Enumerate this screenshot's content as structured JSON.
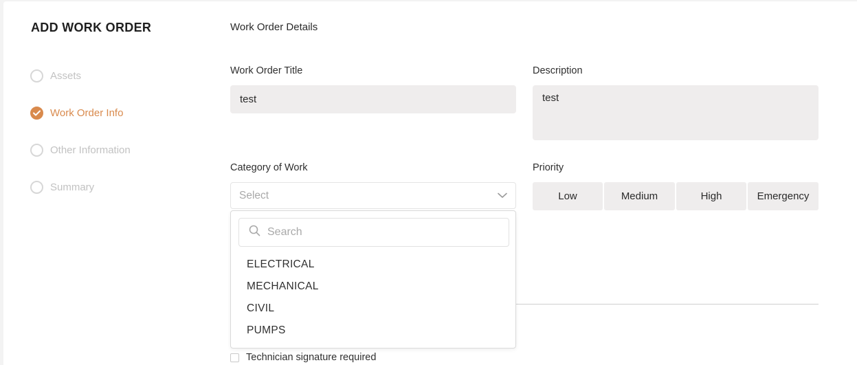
{
  "page": {
    "title": "ADD WORK ORDER"
  },
  "steps": [
    {
      "label": "Assets",
      "state": "pending"
    },
    {
      "label": "Work Order Info",
      "state": "done"
    },
    {
      "label": "Other Information",
      "state": "pending"
    },
    {
      "label": "Summary",
      "state": "pending"
    }
  ],
  "section": {
    "title": "Work Order Details"
  },
  "form": {
    "title_label": "Work Order Title",
    "title_value": "test",
    "description_label": "Description",
    "description_value": "test",
    "category_label": "Category of Work",
    "category_placeholder": "Select",
    "priority_label": "Priority",
    "priority_options": [
      "Low",
      "Medium",
      "High",
      "Emergency"
    ],
    "signature_label": "Technician signature required"
  },
  "dropdown": {
    "search_placeholder": "Search",
    "options": [
      "ELECTRICAL",
      "MECHANICAL",
      "CIVIL",
      "PUMPS"
    ]
  },
  "colors": {
    "accent": "#d98a4d",
    "input_bg": "#efeded",
    "muted_text": "#c2c2c2"
  },
  "icons": {
    "step_done": "check-circle-icon",
    "step_pending": "circle-icon",
    "select_caret": "chevron-down-icon",
    "search": "search-icon"
  }
}
